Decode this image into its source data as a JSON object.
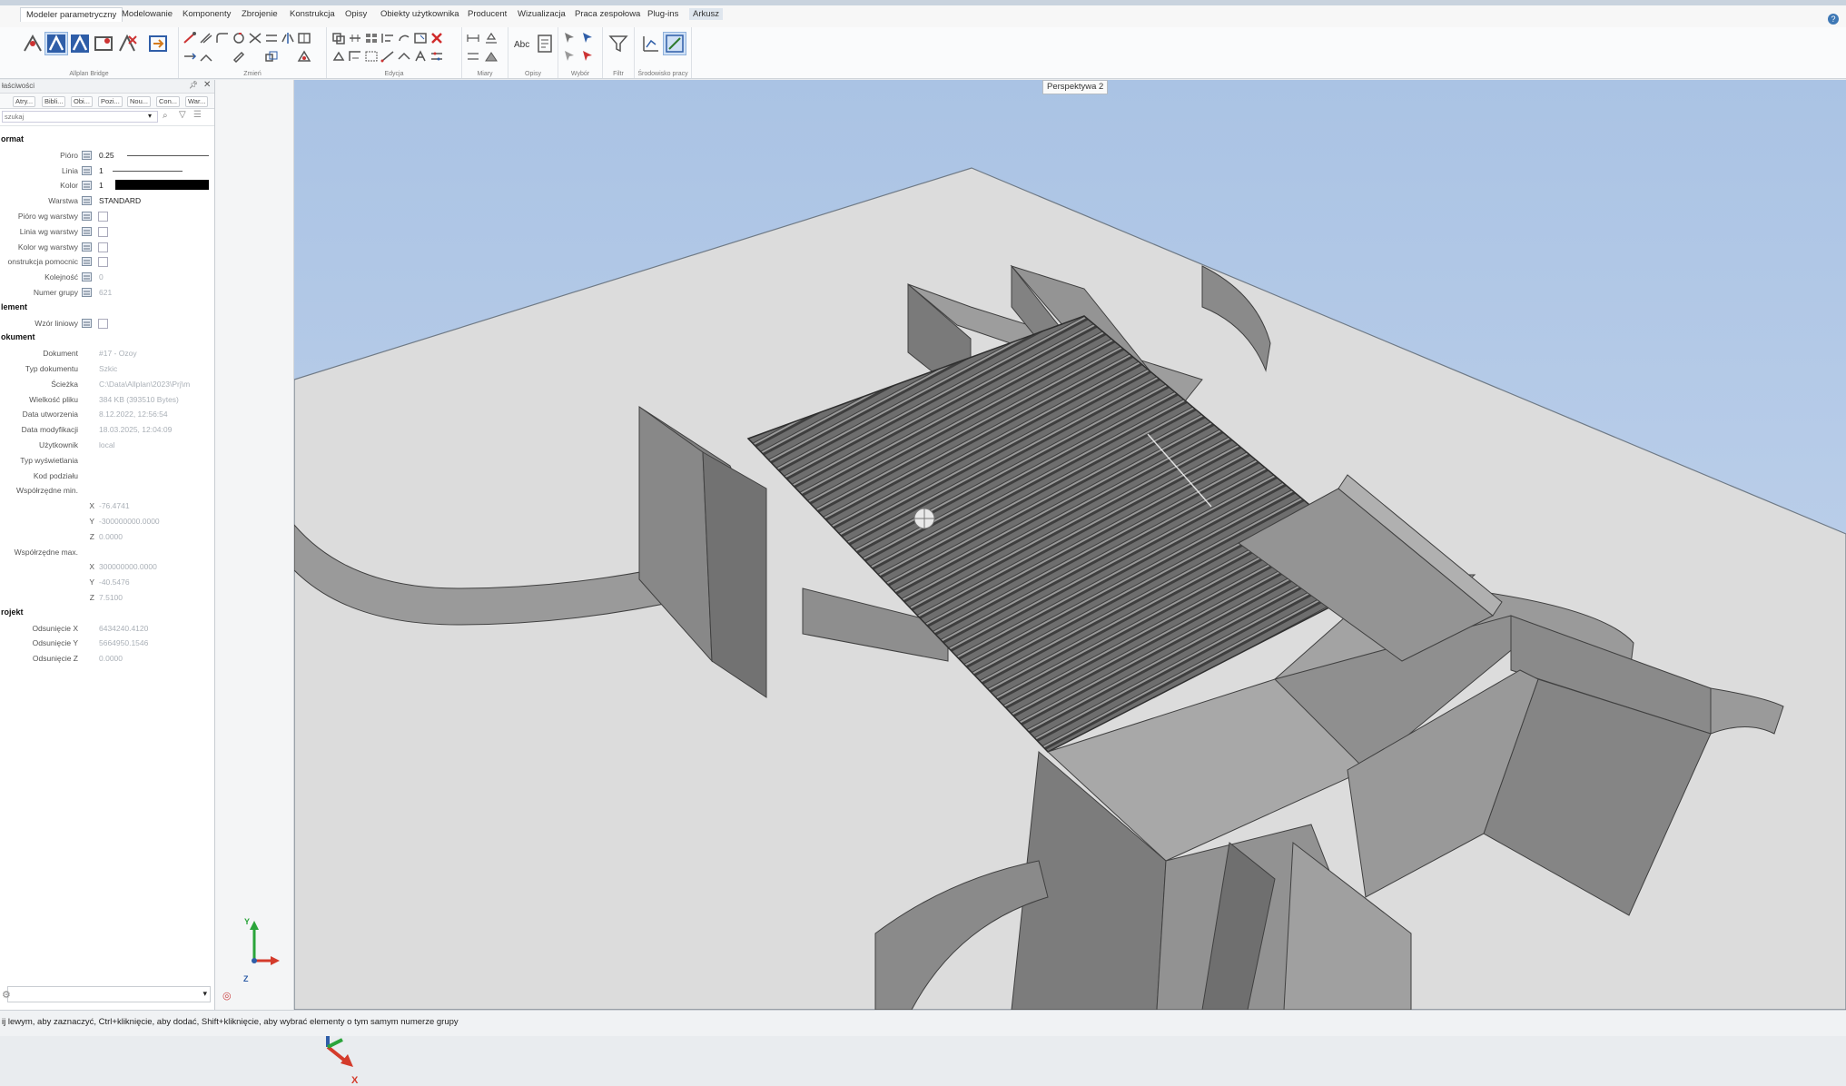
{
  "tabs": [
    "Modeler parametryczny",
    "Modelowanie",
    "Komponenty",
    "Zbrojenie",
    "Konstrukcja",
    "Opisy",
    "Obiekty użytkownika",
    "Producent",
    "Wizualizacja",
    "Praca zespołowa",
    "Plug-ins",
    "Arkusz"
  ],
  "active_tab": "Modeler parametryczny",
  "ribbon_groups": [
    "Allplan Bridge",
    "Zmień",
    "Edycja",
    "Miary",
    "Opisy",
    "Wybór",
    "Filtr",
    "Środowisko pracy"
  ],
  "panel": {
    "title": "łaściwości",
    "tabs": [
      "Atry...",
      "Bibli...",
      "Obi...",
      "Pozi...",
      "Nou...",
      "Con...",
      "War..."
    ],
    "search_placeholder": "szukaj",
    "sections": {
      "format": "ormat",
      "element": "lement",
      "dokument": "okument",
      "projekt": "rojekt"
    },
    "format_rows": [
      {
        "label": "Pióro",
        "value": "0.25"
      },
      {
        "label": "Linia",
        "value": "1"
      },
      {
        "label": "Kolor",
        "value": "1"
      },
      {
        "label": "Warstwa",
        "value": "STANDARD"
      },
      {
        "label": "Pióro wg warstwy",
        "value": ""
      },
      {
        "label": "Linia wg warstwy",
        "value": ""
      },
      {
        "label": "Kolor wg warstwy",
        "value": ""
      },
      {
        "label": "onstrukcja pomocnic",
        "value": ""
      },
      {
        "label": "Kolejność",
        "value": "0"
      },
      {
        "label": "Numer grupy",
        "value": "621"
      }
    ],
    "element_rows": [
      {
        "label": "Wzór liniowy",
        "value": ""
      }
    ],
    "dokument_rows": [
      {
        "label": "Dokument",
        "value": "#17 - Ozoy"
      },
      {
        "label": "Typ dokumentu",
        "value": "Szkic"
      },
      {
        "label": "Ścieżka",
        "value": "C:\\Data\\Allplan\\2023\\Prj\\m"
      },
      {
        "label": "Wielkość pliku",
        "value": "384 KB (393510 Bytes)"
      },
      {
        "label": "Data utworzenia",
        "value": "8.12.2022, 12:56:54"
      },
      {
        "label": "Data modyfikacji",
        "value": "18.03.2025, 12:04:09"
      },
      {
        "label": "Użytkownik",
        "value": "local"
      },
      {
        "label": "Typ wyświetlania",
        "value": ""
      },
      {
        "label": "Kod podziału",
        "value": ""
      },
      {
        "label": "Współrzędne min.",
        "value": ""
      },
      {
        "label": "X",
        "value": "-76.4741"
      },
      {
        "label": "Y",
        "value": "-300000000.0000"
      },
      {
        "label": "Z",
        "value": "0.0000"
      },
      {
        "label": "Współrzędne max.",
        "value": ""
      },
      {
        "label": "X",
        "value": "300000000.0000"
      },
      {
        "label": "Y",
        "value": "-40.5476"
      },
      {
        "label": "Z",
        "value": "7.5100"
      }
    ],
    "projekt_rows": [
      {
        "label": "Odsunięcie X",
        "value": "6434240.4120"
      },
      {
        "label": "Odsunięcie Y",
        "value": "5664950.1546"
      },
      {
        "label": "Odsunięcie Z",
        "value": "0.0000"
      }
    ]
  },
  "viewport": {
    "label": "Perspektywa 2",
    "axes": {
      "x": "X",
      "y": "Y",
      "z": "Z"
    }
  },
  "status_text": "ij lewym, aby zaznaczyć, Ctrl+kliknięcie, aby dodać, Shift+kliknięcie, aby wybrać elementy o tym samym numerze grupy",
  "colors": {
    "sky": "#bfd2ea",
    "ground": "#dcdcdc",
    "model": "#8d8d8d",
    "accent": "#3e78b5"
  },
  "icons": [
    "search-icon",
    "filter-icon",
    "close-icon",
    "pin-icon",
    "help-icon",
    "axis-gizmo-icon",
    "cursor-crosshair-icon"
  ]
}
